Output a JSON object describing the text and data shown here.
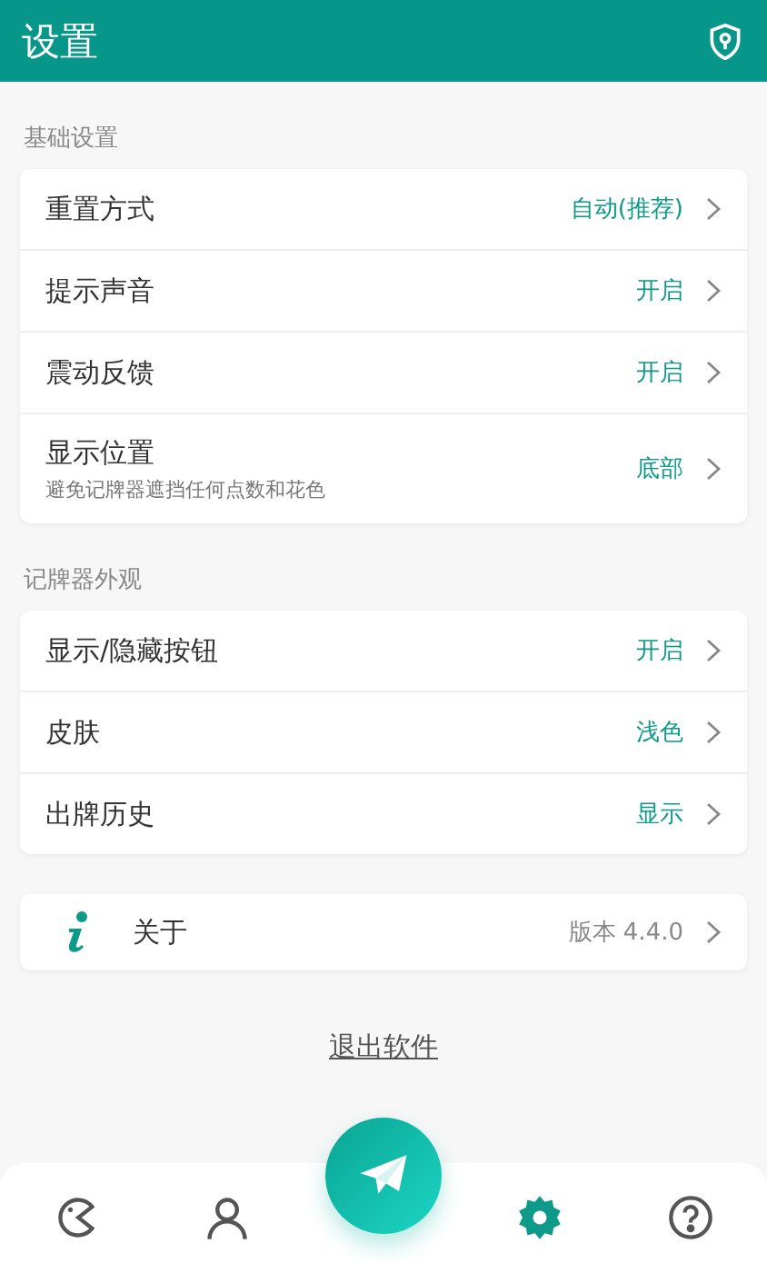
{
  "header": {
    "title": "设置"
  },
  "sections": [
    {
      "label": "基础设置",
      "rows": [
        {
          "label": "重置方式",
          "value": "自动(推荐)"
        },
        {
          "label": "提示声音",
          "value": "开启"
        },
        {
          "label": "震动反馈",
          "value": "开启"
        },
        {
          "label": "显示位置",
          "hint": "避免记牌器遮挡任何点数和花色",
          "value": "底部"
        }
      ]
    },
    {
      "label": "记牌器外观",
      "rows": [
        {
          "label": "显示/隐藏按钮",
          "value": "开启"
        },
        {
          "label": "皮肤",
          "value": "浅色"
        },
        {
          "label": "出牌历史",
          "value": "显示"
        }
      ]
    }
  ],
  "about": {
    "label": "关于",
    "value": "版本 4.4.0"
  },
  "exit_link": "退出软件",
  "nav": [
    {
      "kind": "game",
      "selected": false
    },
    {
      "kind": "profile",
      "selected": false
    },
    {
      "kind": "send",
      "selected": false
    },
    {
      "kind": "settings",
      "selected": true
    },
    {
      "kind": "help",
      "selected": false
    }
  ]
}
